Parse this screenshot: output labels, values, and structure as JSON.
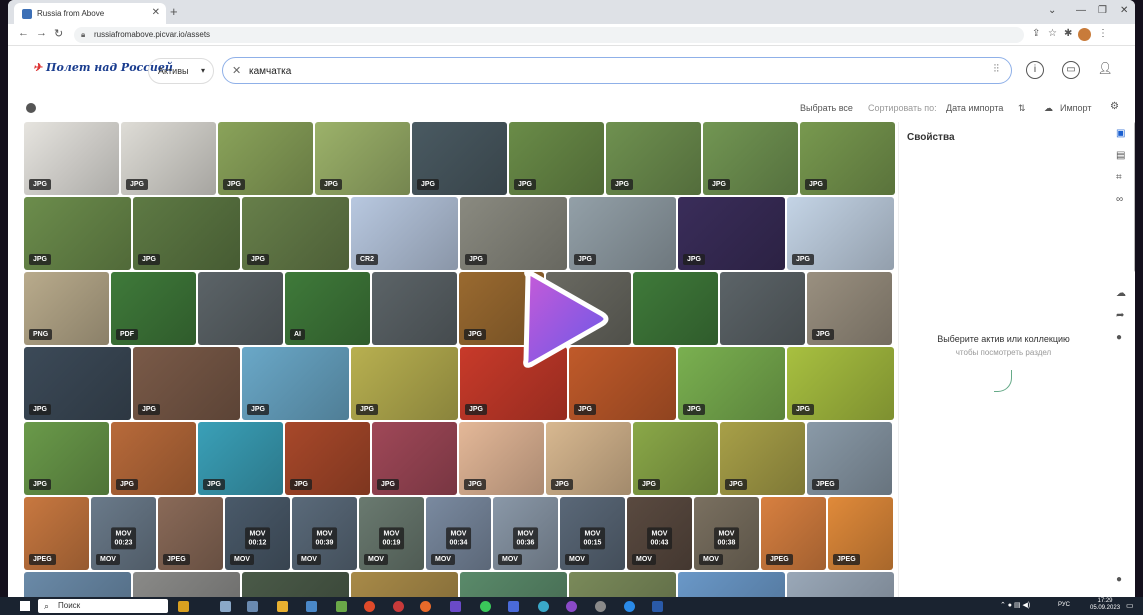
{
  "browser": {
    "tab_title": "Russia from Above",
    "url": "russiafromabove.picvar.io/assets"
  },
  "app": {
    "logo_text": "Полет над Россией",
    "assets_dropdown": "Активы",
    "search_value": "камчатка"
  },
  "toolbar": {
    "select_all": "Выбрать все",
    "sort_label": "Сортировать по:",
    "sort_value": "Дата импорта",
    "import": "Импорт"
  },
  "grid": {
    "rows": [
      [
        {
          "label": "JPG",
          "color": "#e6e4df"
        },
        {
          "label": "JPG",
          "color": "#dedcd6"
        },
        {
          "label": "JPG",
          "color": "#8aa35a"
        },
        {
          "label": "JPG",
          "color": "#9cb26a"
        },
        {
          "label": "JPG",
          "color": "#4a5a62"
        },
        {
          "label": "JPG",
          "color": "#6a8c48"
        },
        {
          "label": "JPG",
          "color": "#6f9150"
        },
        {
          "label": "JPG",
          "color": "#729653"
        },
        {
          "label": "JPG",
          "color": "#78994f"
        }
      ],
      [
        {
          "label": "JPG",
          "color": "#6c8d4c"
        },
        {
          "label": "JPG",
          "color": "#5e7a44"
        },
        {
          "label": "JPG",
          "color": "#677f4a"
        },
        {
          "label": "CR2",
          "color": "#b8c8e0"
        },
        {
          "label": "JPG",
          "color": "#8a8a80"
        },
        {
          "label": "JPG",
          "color": "#93a0a8"
        },
        {
          "label": "JPG",
          "color": "#3a2d5a"
        },
        {
          "label": "JPG",
          "color": "#c4d4e6"
        }
      ],
      [
        {
          "label": "PNG",
          "color": "#b9ab8c"
        },
        {
          "label": "PDF",
          "color": "#3f7a3a"
        },
        {
          "label": "",
          "color": "#5c6468"
        },
        {
          "label": "AI",
          "color": "#3f7a3a"
        },
        {
          "label": "",
          "color": "#5c6468"
        },
        {
          "label": "JPG",
          "color": "#9a6a30"
        },
        {
          "label": "",
          "color": "#6a6a62"
        },
        {
          "label": "",
          "color": "#3f7a3a"
        },
        {
          "label": "",
          "color": "#5c6468"
        },
        {
          "label": "JPG",
          "color": "#9a9080"
        }
      ],
      [
        {
          "label": "JPG",
          "color": "#3c4a58"
        },
        {
          "label": "JPG",
          "color": "#7a5a48"
        },
        {
          "label": "JPG",
          "color": "#6aa8c8"
        },
        {
          "label": "JPG",
          "color": "#b8b050"
        },
        {
          "label": "JPG",
          "color": "#c83a2a"
        },
        {
          "label": "JPG",
          "color": "#c05a2a"
        },
        {
          "label": "JPG",
          "color": "#7ab050"
        },
        {
          "label": "JPG",
          "color": "#a8c040"
        }
      ],
      [
        {
          "label": "JPG",
          "color": "#6a9a4a"
        },
        {
          "label": "JPG",
          "color": "#b86a3a"
        },
        {
          "label": "JPG",
          "color": "#3aa0b8"
        },
        {
          "label": "JPG",
          "color": "#a8482a"
        },
        {
          "label": "JPG",
          "color": "#a04858"
        },
        {
          "label": "JPG",
          "color": "#e4b898"
        },
        {
          "label": "JPG",
          "color": "#d8b890"
        },
        {
          "label": "JPG",
          "color": "#8aa848"
        },
        {
          "label": "JPG",
          "color": "#a8a048"
        },
        {
          "label": "JPEG",
          "color": "#8a9aa8"
        }
      ],
      [
        {
          "label": "JPEG",
          "color": "#c87840"
        },
        {
          "label": "MOV",
          "duration": "00:23",
          "color": "#6a7a8a"
        },
        {
          "label": "JPEG",
          "color": "#8a6a58"
        },
        {
          "label": "MOV",
          "duration": "00:12",
          "color": "#4a5a6a"
        },
        {
          "label": "MOV",
          "duration": "00:39",
          "color": "#5a6a7a"
        },
        {
          "label": "MOV",
          "duration": "00:19",
          "color": "#6a7a70"
        },
        {
          "label": "MOV",
          "duration": "00:34",
          "color": "#7a8aa0"
        },
        {
          "label": "MOV",
          "duration": "00:36",
          "color": "#8a98a8"
        },
        {
          "label": "MOV",
          "duration": "00:15",
          "color": "#5a6878"
        },
        {
          "label": "MOV",
          "duration": "00:43",
          "color": "#5a4a40"
        },
        {
          "label": "MOV",
          "duration": "00:38",
          "color": "#7a7060"
        },
        {
          "label": "JPEG",
          "color": "#d88040"
        },
        {
          "label": "JPEG",
          "color": "#e08a3a"
        }
      ],
      [
        {
          "label": "",
          "color": "#6a8aa8"
        },
        {
          "label": "",
          "color": "#8a8a88"
        },
        {
          "label": "",
          "color": "#4a5a48"
        },
        {
          "label": "",
          "color": "#a88a48"
        },
        {
          "label": "",
          "color": "#5a8a6a"
        },
        {
          "label": "",
          "color": "#7a8a5a"
        },
        {
          "label": "",
          "color": "#6a98c8"
        },
        {
          "label": "",
          "color": "#9aa8b8"
        }
      ]
    ]
  },
  "properties": {
    "title": "Свойства",
    "empty_title": "Выберите актив или коллекцию",
    "empty_subtitle": "чтобы посмотреть раздел"
  },
  "taskbar": {
    "search_placeholder": "Поиск",
    "lang": "РУС",
    "time": "17:29",
    "date": "05.09.2023"
  },
  "colors": {
    "accent": "#1a3d8f",
    "play_gradient_start": "#c65ad8",
    "play_gradient_end": "#6a58e8"
  }
}
